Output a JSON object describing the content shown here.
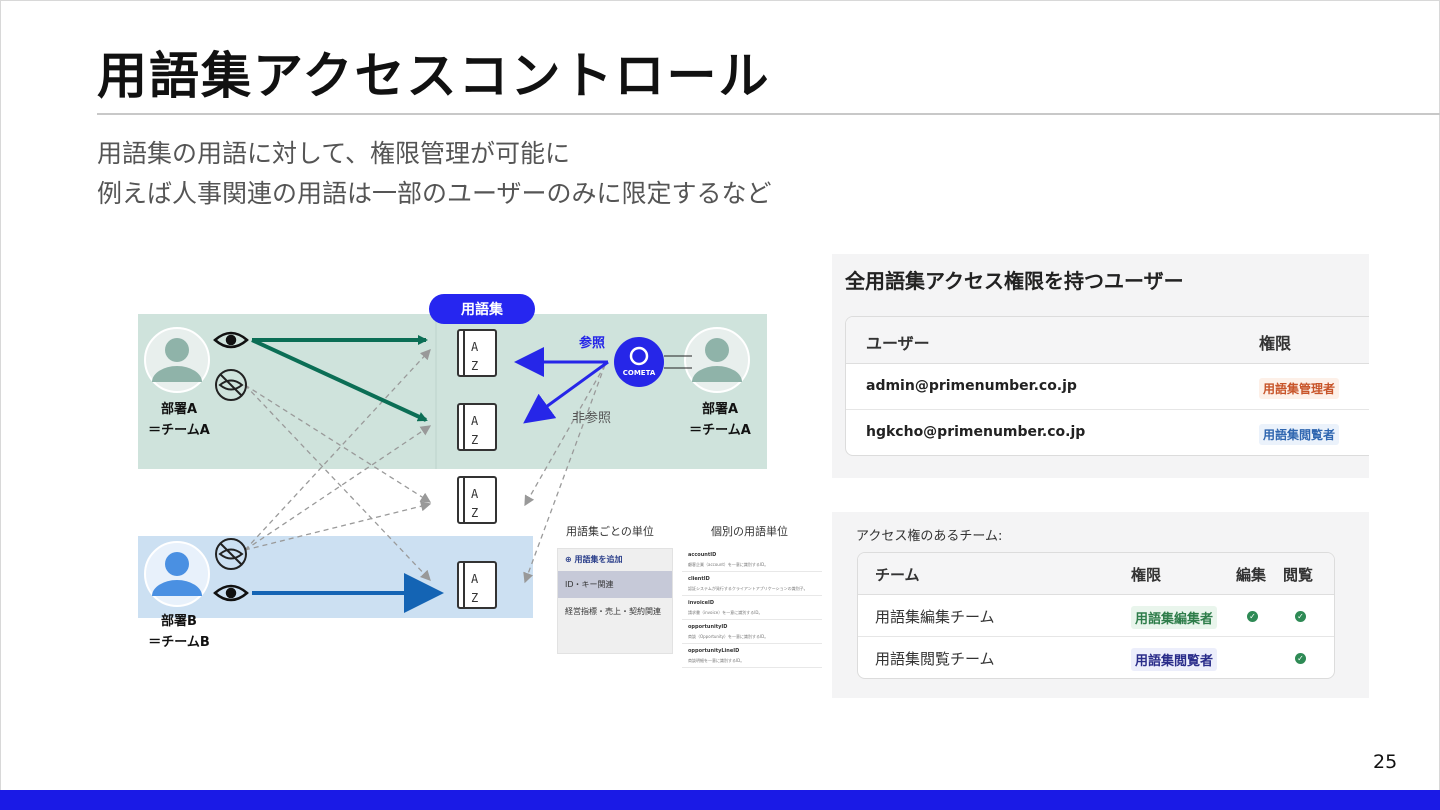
{
  "slide": {
    "title": "用語集アクセスコントロール",
    "subtitle_1": "用語集の用語に対して、権限管理が可能に",
    "subtitle_2": "例えば人事関連の用語は一部のユーザーのみに限定するなど",
    "page_number": "25",
    "accent_color": "#1a1ae6"
  },
  "diagram": {
    "glossary_pill": "用語集",
    "dept_a_left_line1": "部署A",
    "dept_a_left_line2": "＝チームA",
    "dept_b_line1": "部署B",
    "dept_b_line2": "＝チームB",
    "dept_a_right_line1": "部署A",
    "dept_a_right_line2": "＝チームA",
    "ref_label": "参照",
    "nonref_label": "非参照",
    "cometa_label": "COMETA",
    "colors": {
      "team_a": "#cfe3dc",
      "team_b": "#cce0f2",
      "green_arrow": "#0b6e55",
      "blue_arrow": "#1464b4",
      "ref_arrow": "#2626e8"
    },
    "icons": [
      "eye-icon",
      "eye-slash-icon",
      "book-icon",
      "user-icon",
      "cometa-logo-icon"
    ]
  },
  "mini": {
    "caption_left": "用語集ごとの単位",
    "caption_right": "個別の用語単位",
    "add_label": "用語集を追加",
    "groups": [
      "ID・キー関連",
      "経営指標・売上・契約関連"
    ],
    "terms": [
      {
        "key": "accountID",
        "desc": "顧客企業（account）を一意に識別するID。"
      },
      {
        "key": "clientID",
        "desc": "認証システムが発行するクライアントアプリケーションの識別子。"
      },
      {
        "key": "invoiceID",
        "desc": "請求書（invoice）を一意に識別するID。"
      },
      {
        "key": "opportunityID",
        "desc": "商談（Opportunity）を一意に識別するID。"
      },
      {
        "key": "opportunityLineID",
        "desc": "商談明細を一意に識別するID。"
      }
    ]
  },
  "panel_users": {
    "title": "全用語集アクセス権限を持つユーザー",
    "header_user": "ユーザー",
    "header_role": "権限",
    "rows": [
      {
        "user": "admin@primenumber.co.jp",
        "role": "用語集管理者"
      },
      {
        "user": "hgkcho@primenumber.co.jp",
        "role": "用語集閲覧者"
      }
    ]
  },
  "panel_teams": {
    "title": "アクセス権のあるチーム:",
    "header_team": "チーム",
    "header_role": "権限",
    "header_edit": "編集",
    "header_view": "閲覧",
    "rows": [
      {
        "team": "用語集編集チーム",
        "role": "用語集編集者",
        "edit": true,
        "view": true
      },
      {
        "team": "用語集閲覧チーム",
        "role": "用語集閲覧者",
        "edit": false,
        "view": true
      }
    ]
  }
}
